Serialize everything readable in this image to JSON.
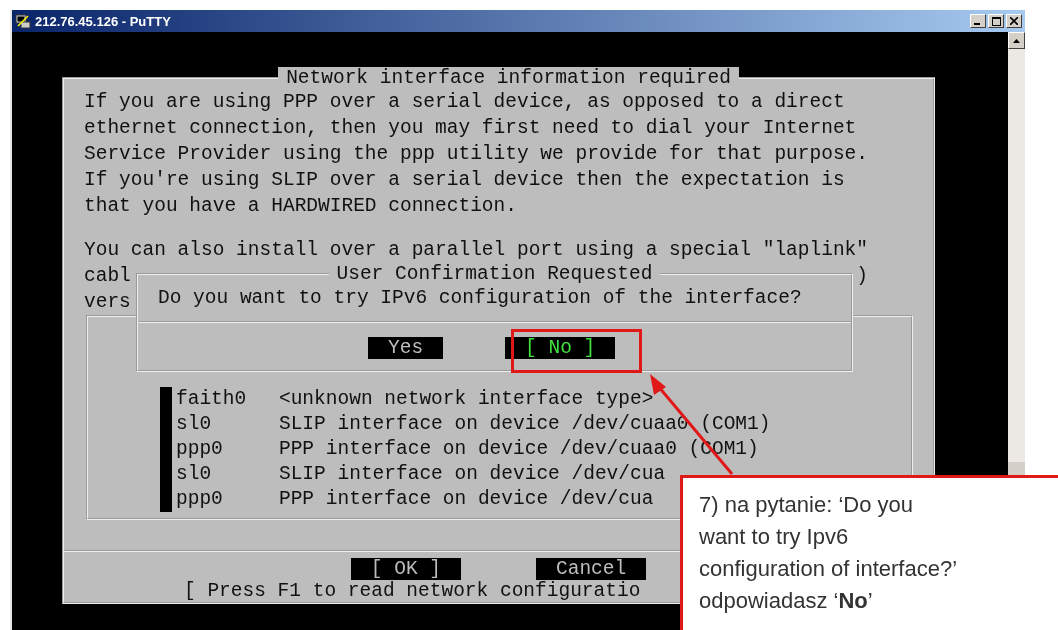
{
  "window": {
    "title": "212.76.45.126 - PuTTY"
  },
  "main_dialog": {
    "title": "Network interface information required",
    "paragraph_1": [
      "If you are using PPP over a serial device, as opposed to a direct",
      "ethernet connection, then you may first need to dial your Internet",
      "Service Provider using the ppp utility we provide for that purpose.",
      "If you're using SLIP over a serial device then the expectation is",
      "that you have a HARDWIRED connection."
    ],
    "paragraph_2": "You can also install over a parallel port using a special \"laplink\"",
    "obscured_lines": [
      {
        "left": "cabl",
        "right": ")"
      },
      {
        "left": "vers"
      }
    ],
    "interfaces": [
      {
        "name": "faith0",
        "description": "<unknown network interface type>"
      },
      {
        "name": "sl0",
        "description": "SLIP interface on device /dev/cuaa0 (COM1)"
      },
      {
        "name": "ppp0",
        "description": "PPP interface on device /dev/cuaa0 (COM1)"
      },
      {
        "name": "sl0",
        "description": "SLIP interface on device /dev/cua"
      },
      {
        "name": "ppp0",
        "description": "PPP interface on device /dev/cua"
      }
    ],
    "buttons": [
      "[ OK ]",
      "Cancel"
    ],
    "help_line": "[ Press F1 to read network configuratio"
  },
  "confirm_dialog": {
    "title": "User Confirmation Requested",
    "question": "Do you want to try IPv6 configuration of the interface?",
    "buttons": [
      {
        "label": "Yes",
        "selected": false
      },
      {
        "label": "[ No ]",
        "selected": true
      }
    ]
  },
  "callout": {
    "lines": [
      "7) na pytanie: ‘Do you",
      "want to try Ipv6",
      "configuration of interface?’",
      "odpowiadasz ‘**No**’"
    ]
  }
}
